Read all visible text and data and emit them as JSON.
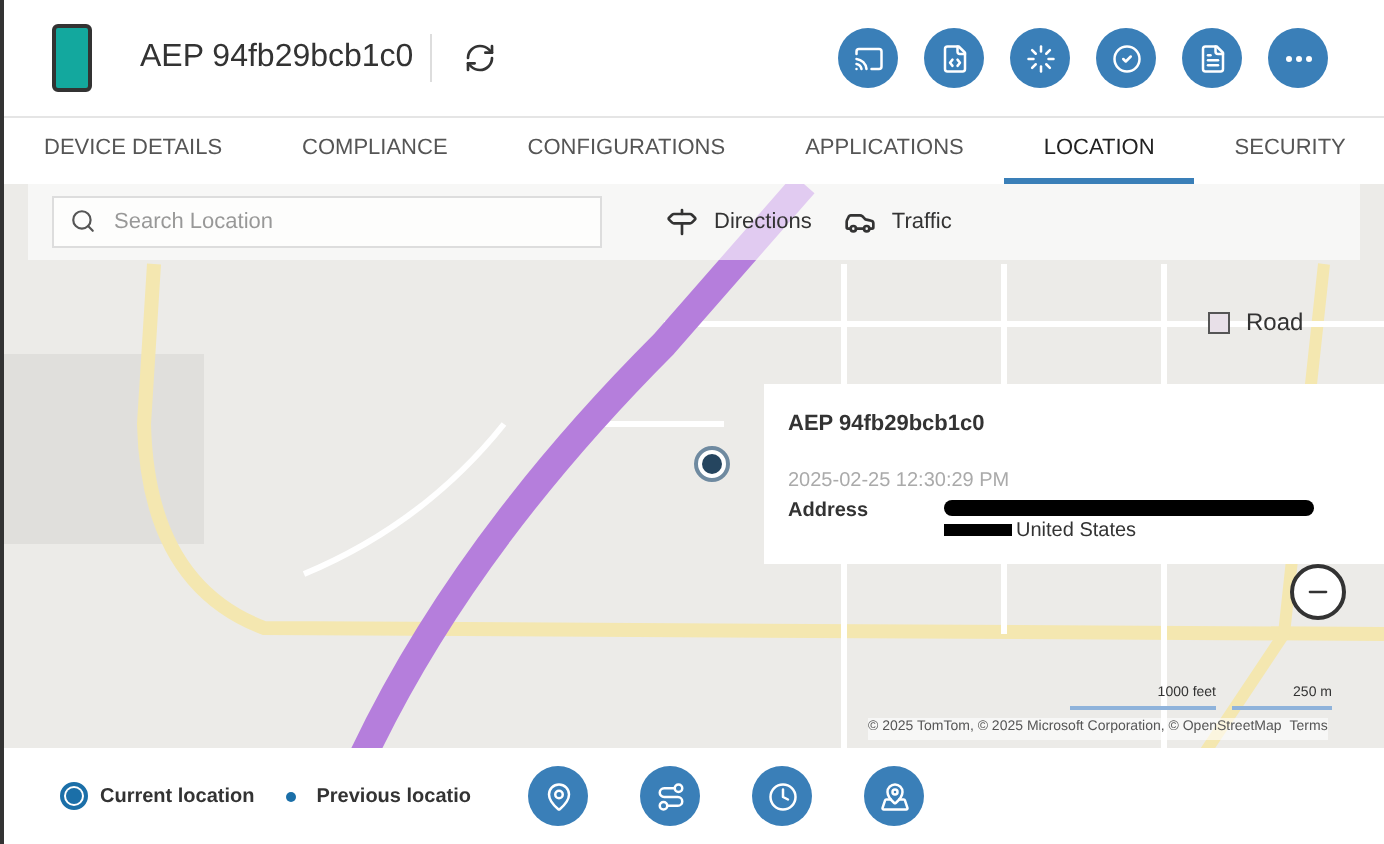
{
  "device": {
    "title": "AEP 94fb29bcb1c0"
  },
  "tabs": [
    {
      "label": "DEVICE DETAILS",
      "selected": false
    },
    {
      "label": "COMPLIANCE",
      "selected": false
    },
    {
      "label": "CONFIGURATIONS",
      "selected": false
    },
    {
      "label": "APPLICATIONS",
      "selected": false
    },
    {
      "label": "LOCATION",
      "selected": true
    },
    {
      "label": "SECURITY",
      "selected": false
    }
  ],
  "map_toolbar": {
    "search": {
      "placeholder": "Search Location"
    },
    "buttons": [
      {
        "kind": "directions",
        "label": "Directions"
      },
      {
        "kind": "traffic",
        "label": "Traffic"
      }
    ]
  },
  "map": {
    "style_label": "Road",
    "popup": {
      "title": "AEP 94fb29bcb1c0",
      "time": "2025-02-25 12:30:29 PM",
      "address_label": "Address",
      "address_tail": "United States"
    },
    "scale": [
      "1000 feet",
      "250 m"
    ],
    "attribution": "© 2025 TomTom, © 2025 Microsoft Corporation, © OpenStreetMap",
    "terms": "Terms"
  },
  "legend": [
    {
      "kind": "current",
      "label": "Current location"
    },
    {
      "kind": "previous",
      "label": "Previous locatio"
    }
  ]
}
